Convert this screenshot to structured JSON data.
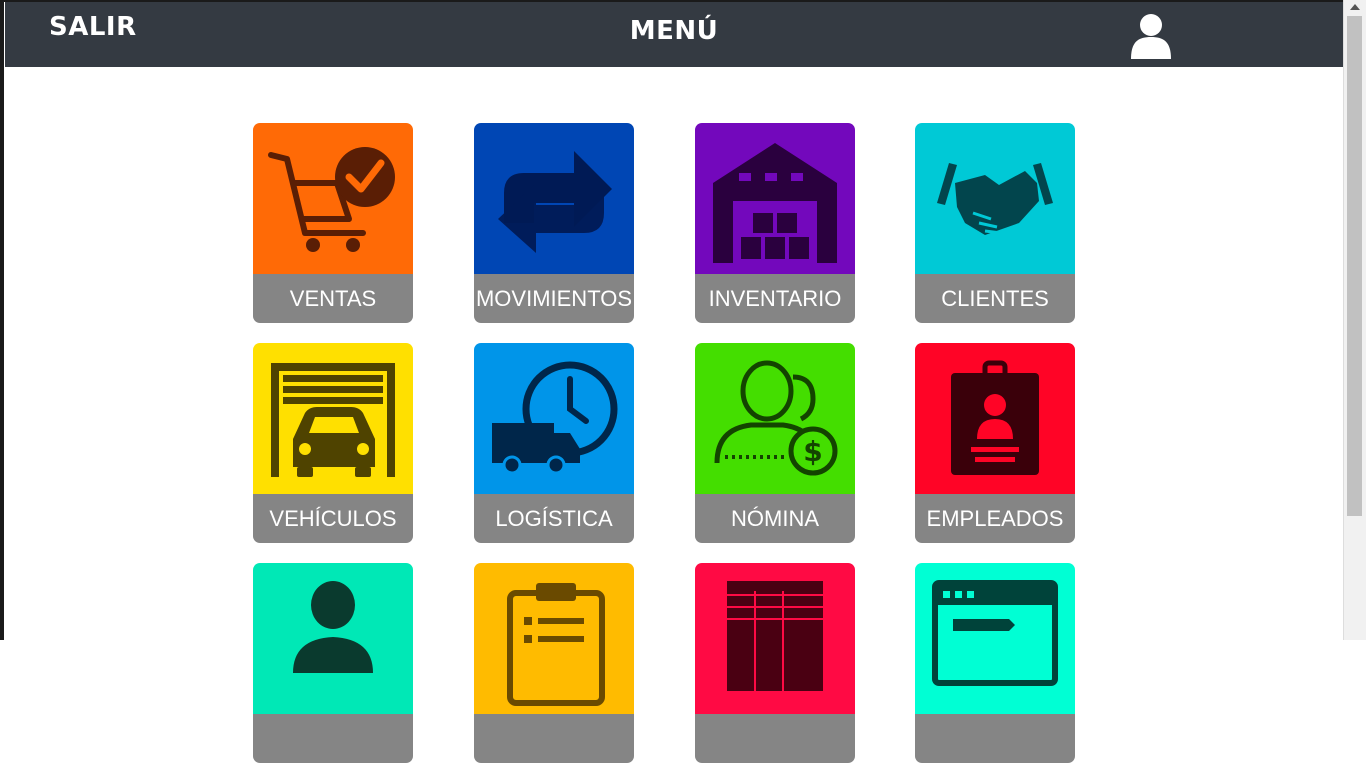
{
  "header": {
    "logout_label": "SALIR",
    "title": "MENÚ",
    "user_icon": "user-icon"
  },
  "tiles": [
    {
      "label": "VENTAS",
      "color": "#ff6a06",
      "icon": "cart-check-icon"
    },
    {
      "label": "MOVIMIENTOS",
      "color": "#0046b4",
      "icon": "exchange-arrows-icon"
    },
    {
      "label": "INVENTARIO",
      "color": "#7308bc",
      "icon": "warehouse-icon"
    },
    {
      "label": "CLIENTES",
      "color": "#00c9d6",
      "icon": "handshake-icon"
    },
    {
      "label": "VEHÍCULOS",
      "color": "#ffe000",
      "icon": "car-garage-icon"
    },
    {
      "label": "LOGÍSTICA",
      "color": "#0095e9",
      "icon": "truck-clock-icon"
    },
    {
      "label": "NÓMINA",
      "color": "#44de00",
      "icon": "payroll-person-icon"
    },
    {
      "label": "EMPLEADOS",
      "color": "#ff0426",
      "icon": "id-badge-icon"
    },
    {
      "label": "",
      "color": "#00e8b6",
      "icon": "person-icon"
    },
    {
      "label": "",
      "color": "#ffbb00",
      "icon": "clipboard-icon"
    },
    {
      "label": "",
      "color": "#ff0a44",
      "icon": "spreadsheet-icon"
    },
    {
      "label": "",
      "color": "#00ffd4",
      "icon": "browser-window-icon"
    }
  ]
}
